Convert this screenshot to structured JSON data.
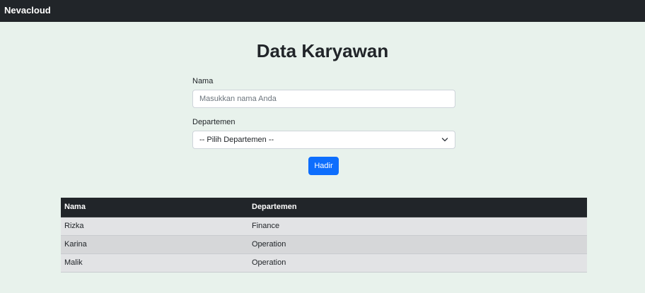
{
  "navbar": {
    "brand": "Nevacloud"
  },
  "page": {
    "title": "Data Karyawan"
  },
  "form": {
    "nama_label": "Nama",
    "nama_placeholder": "Masukkan nama Anda",
    "nama_value": "",
    "departemen_label": "Departemen",
    "departemen_selected": "-- Pilih Departemen --",
    "submit_label": "Hadir"
  },
  "table": {
    "headers": [
      "Nama",
      "Departemen"
    ],
    "rows": [
      {
        "nama": "Rizka",
        "departemen": "Finance"
      },
      {
        "nama": "Karina",
        "departemen": "Operation"
      },
      {
        "nama": "Malik",
        "departemen": "Operation"
      }
    ]
  },
  "icons": {
    "select_chevron": "chevron-down-icon"
  },
  "colors": {
    "navbar_bg": "#212529",
    "page_bg": "#e8f2ec",
    "button_primary": "#0d6efd"
  }
}
